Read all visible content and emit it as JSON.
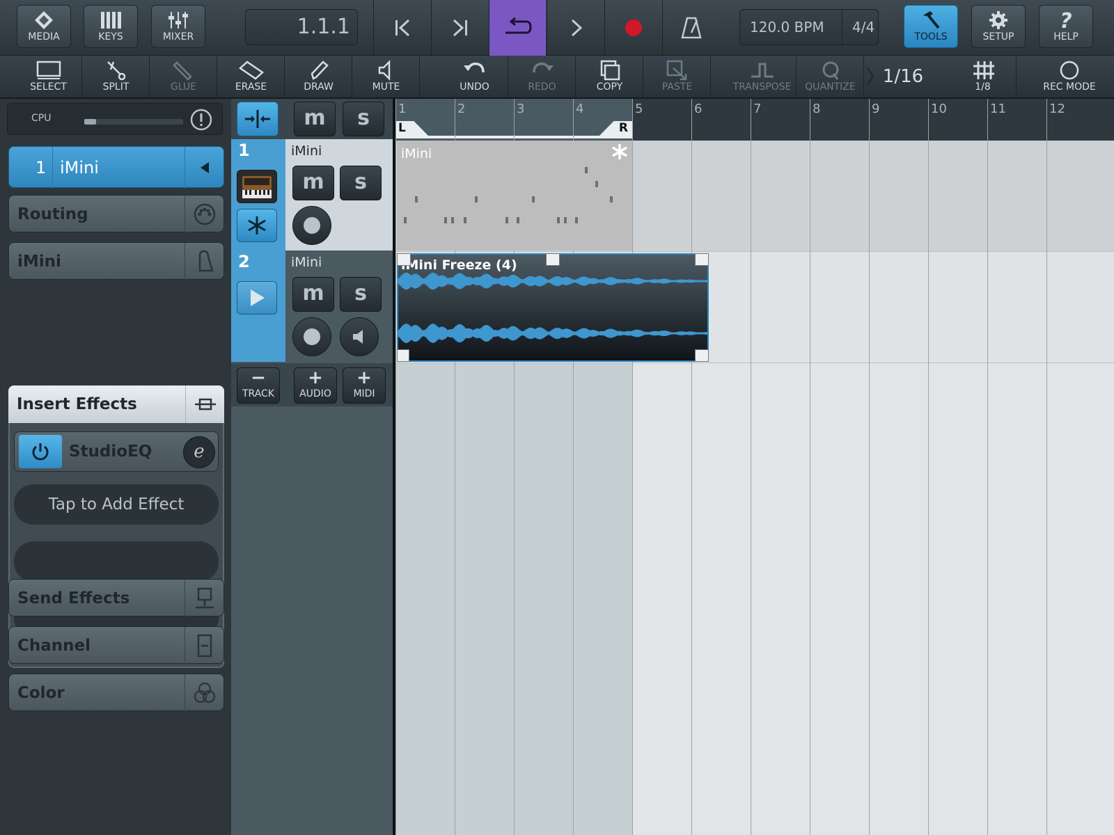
{
  "topbar": {
    "media": "MEDIA",
    "keys": "KEYS",
    "mixer": "MIXER",
    "position": "1.1.1",
    "tempo": "120.0 BPM",
    "signature": "4/4",
    "tools": "TOOLS",
    "setup": "SETUP",
    "help": "HELP"
  },
  "toolbar": {
    "select": "SELECT",
    "split": "SPLIT",
    "glue": "GLUE",
    "erase": "ERASE",
    "draw": "DRAW",
    "mute": "MUTE",
    "undo": "UNDO",
    "redo": "REDO",
    "copy": "COPY",
    "paste": "PASTE",
    "transpose": "TRANSPOSE",
    "quantize": "QUANTIZE",
    "quantize_value": "1/16",
    "grid": "1/8",
    "rec_mode": "REC MODE"
  },
  "inspector": {
    "cpu_label": "CPU",
    "cpu_level": 0.12,
    "track_number": "1",
    "track_name": "iMini",
    "routing": "Routing",
    "instrument": "iMini",
    "insert_effects": "Insert Effects",
    "effect_1": "StudioEQ",
    "effect_edit": "e",
    "add_effect": "Tap to Add Effect",
    "send_effects": "Send Effects",
    "channel": "Channel",
    "color": "Color"
  },
  "tracks": [
    {
      "number": "1",
      "name": "iMini"
    },
    {
      "number": "2",
      "name": "iMini"
    }
  ],
  "track_buttons": {
    "mute": "m",
    "solo": "s",
    "track": "TRACK",
    "audio": "AUDIO",
    "midi": "MIDI"
  },
  "ruler": {
    "bars": [
      "1",
      "2",
      "3",
      "4",
      "5",
      "6",
      "7",
      "8",
      "9",
      "10",
      "11",
      "12"
    ],
    "left_locator": "L",
    "right_locator": "R"
  },
  "events": {
    "midi_name": "iMini",
    "audio_name": "iMini Freeze (4)"
  },
  "colors": {
    "accent": "#4a9fd2",
    "loop_active": "#7b57c4",
    "record": "#d0182a"
  }
}
